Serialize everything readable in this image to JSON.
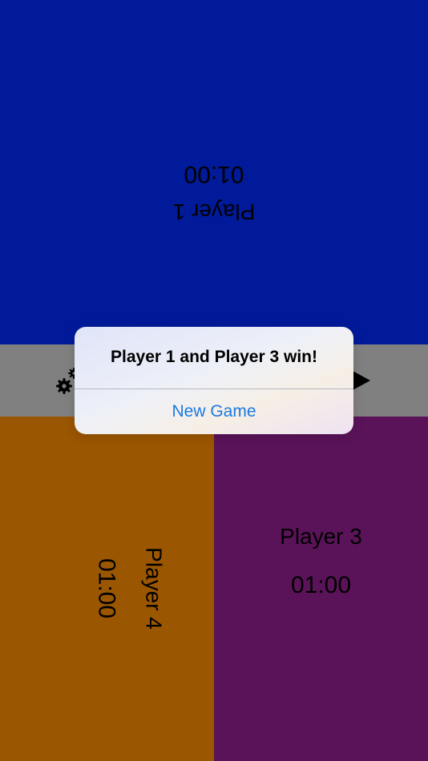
{
  "players": {
    "p1": {
      "name": "Player 1",
      "time": "01:00",
      "color": "#001a99"
    },
    "p3": {
      "name": "Player 3",
      "time": "01:00",
      "color": "#5a1358"
    },
    "p4": {
      "name": "Player 4",
      "time": "01:00",
      "color": "#9a5600"
    }
  },
  "toolbar": {
    "settings_icon": "gear-icon",
    "play_icon": "play-icon",
    "color": "#808080"
  },
  "alert": {
    "message": "Player 1 and Player 3 win!",
    "button_label": "New Game",
    "button_color": "#1a7ae0"
  }
}
